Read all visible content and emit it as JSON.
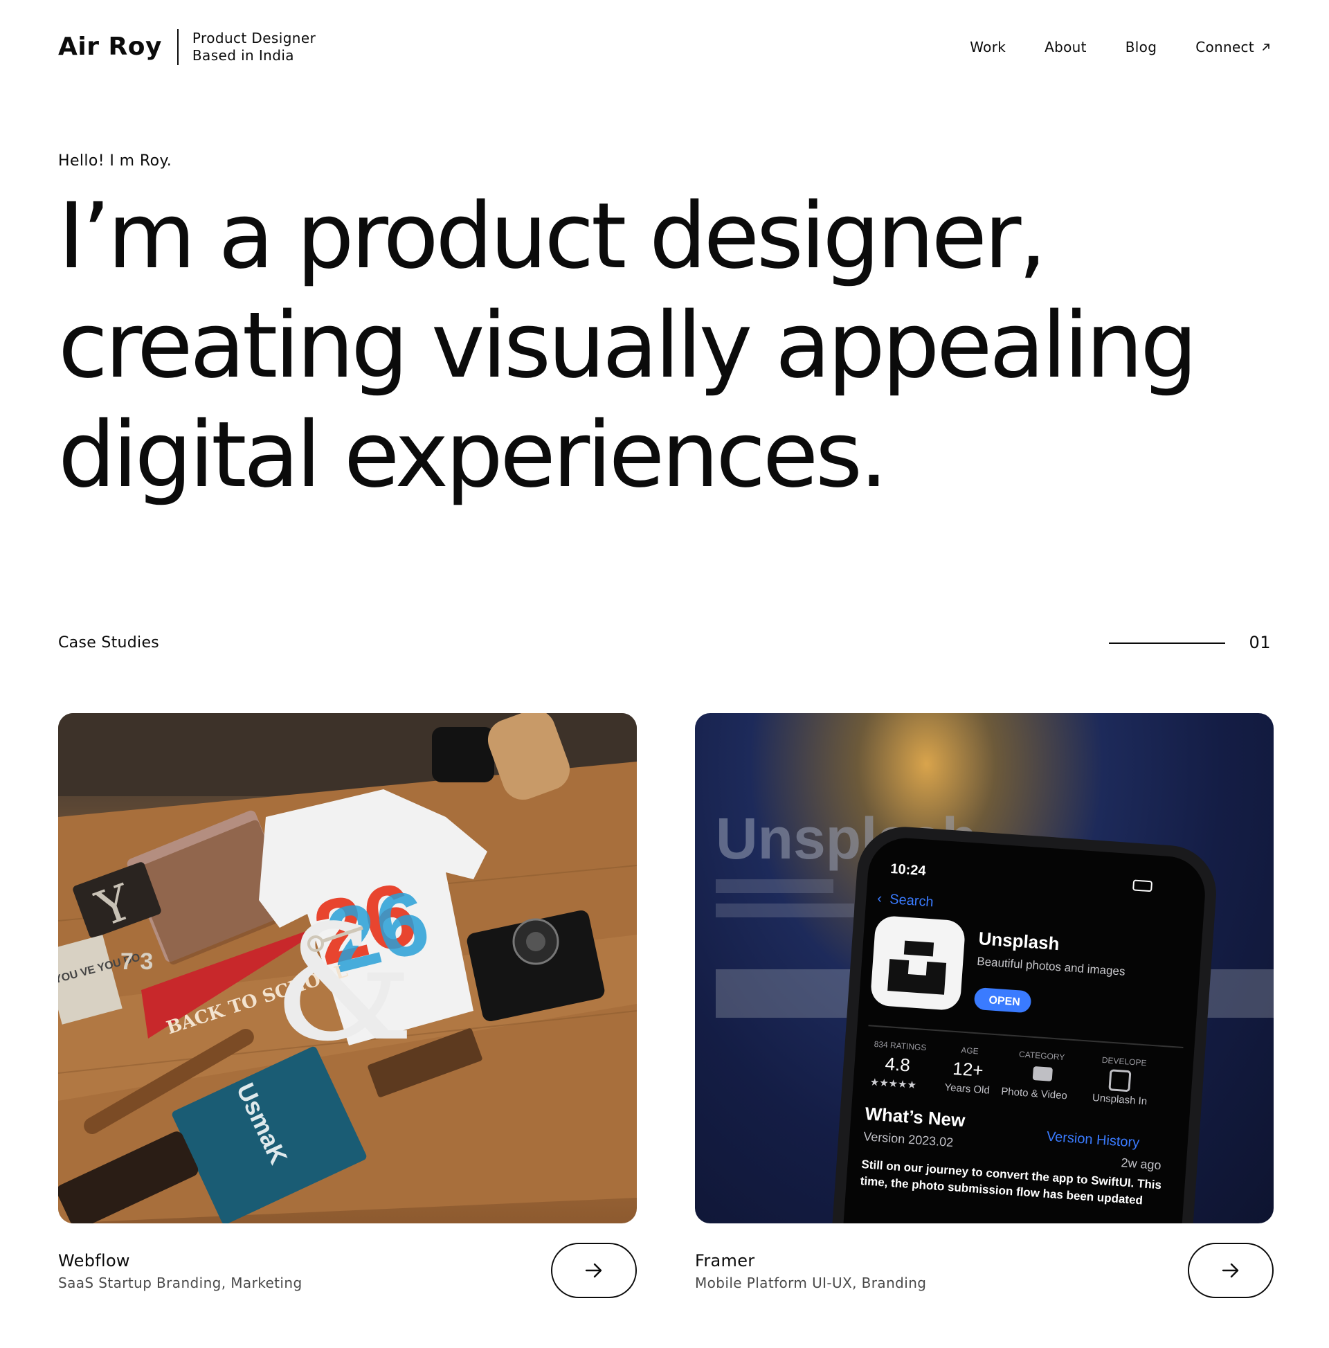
{
  "header": {
    "brand": "Air Roy",
    "tagline_line1": "Product Designer",
    "tagline_line2": "Based in India",
    "nav": {
      "work": "Work",
      "about": "About",
      "blog": "Blog",
      "connect": "Connect"
    }
  },
  "hero": {
    "greeting": "Hello! I m Roy.",
    "line1": "I’m a product designer,",
    "line2": "creating visually appealing",
    "line3": "digital experiences."
  },
  "case_studies": {
    "title": "Case Studies",
    "index": "01",
    "items": [
      {
        "title": "Webflow",
        "subtitle": "SaaS Startup Branding, Marketing",
        "image": {
          "pennant": "BACK TO SCHOOL",
          "shirt": "26",
          "book": "UsmaK",
          "card": "YOU VE YOU DO",
          "numbers": "7 3"
        }
      },
      {
        "title": "Framer",
        "subtitle": "Mobile Platform UI-UX, Branding",
        "image": {
          "backdrop": "Unsplash",
          "time": "10:24",
          "back": "Search",
          "app_name": "Unsplash",
          "app_tagline": "Beautiful photos and images",
          "open": "OPEN",
          "ratings_label": "834 RATINGS",
          "rating": "4.8",
          "stars": "★★★★★",
          "age_label": "AGE",
          "age": "12+",
          "age_sub": "Years Old",
          "category_label": "CATEGORY",
          "category": "Photo & Video",
          "developer_label": "DEVELOPE",
          "developer": "Unsplash In",
          "whats_new": "What’s New",
          "version": "Version 2023.02",
          "version_history": "Version History",
          "ago": "2w ago",
          "notes_1": "Still on our journey to convert the app to SwiftUI. This",
          "notes_2": "time, the photo submission flow has been updated"
        }
      }
    ]
  },
  "colors": {
    "text": "#0b0b0b",
    "muted": "#4a4a4a",
    "background": "#ffffff",
    "link_blue": "#3a7bff"
  }
}
